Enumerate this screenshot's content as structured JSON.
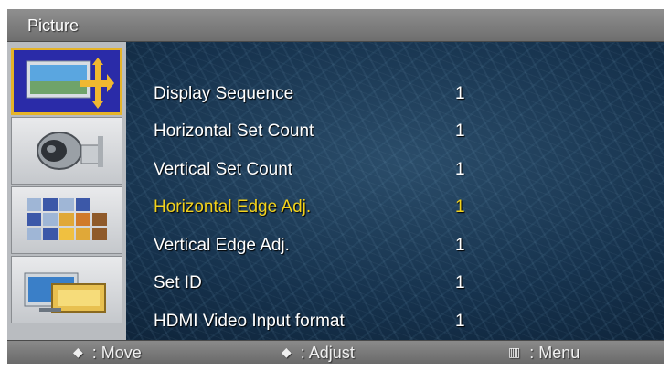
{
  "title": "Picture",
  "sidebar": {
    "items": [
      {
        "icon": "picture-resize-icon",
        "active": true
      },
      {
        "icon": "speaker-sound-icon",
        "active": false
      },
      {
        "icon": "channel-grid-icon",
        "active": false
      },
      {
        "icon": "setup-monitor-icon",
        "active": false
      }
    ]
  },
  "menu": {
    "items": [
      {
        "label": "Display Sequence",
        "value": "1",
        "selected": false
      },
      {
        "label": "Horizontal Set Count",
        "value": "1",
        "selected": false
      },
      {
        "label": "Vertical Set Count",
        "value": "1",
        "selected": false
      },
      {
        "label": "Horizontal Edge Adj.",
        "value": "1",
        "selected": true
      },
      {
        "label": "Vertical Edge Adj.",
        "value": "1",
        "selected": false
      },
      {
        "label": "Set ID",
        "value": "1",
        "selected": false
      },
      {
        "label": "HDMI Video Input format",
        "value": "1",
        "selected": false
      }
    ]
  },
  "footer": {
    "move_icon": "◆",
    "move_label": ": Move",
    "adjust_icon": "◆",
    "adjust_label": ": Adjust",
    "menu_icon": "▥",
    "menu_label": ": Menu"
  },
  "colors": {
    "highlight": "#f2d21c",
    "active_border": "#e6b428",
    "active_fill": "#2a2ba8"
  }
}
